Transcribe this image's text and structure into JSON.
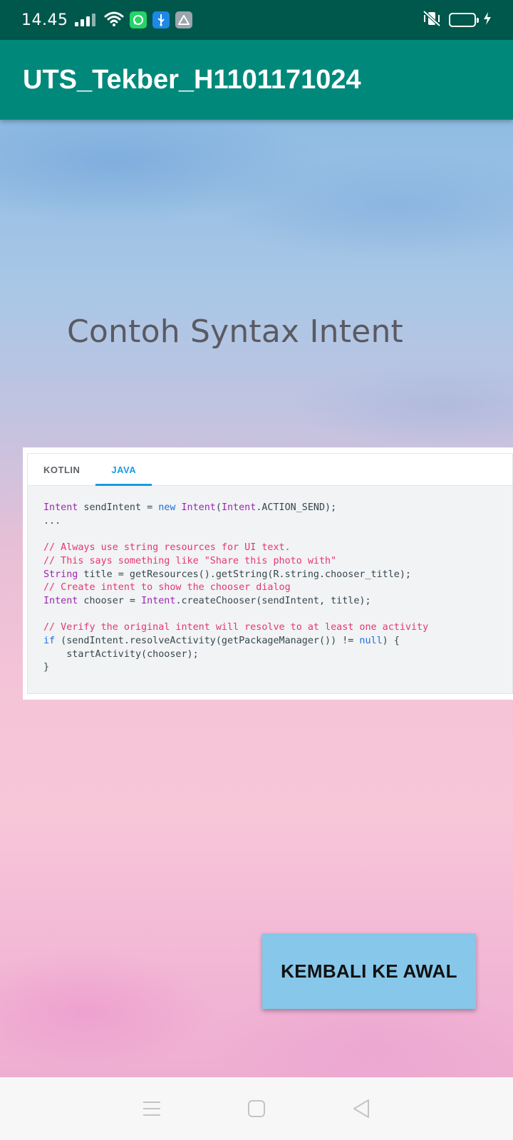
{
  "status_bar": {
    "time": "14.45",
    "icons": [
      "signal-icon",
      "wifi-icon",
      "whatsapp-icon",
      "usb-icon",
      "drive-icon",
      "vibrate-off-icon",
      "battery-icon",
      "charging-icon"
    ]
  },
  "app_bar": {
    "title": "UTS_Tekber_H1101171024",
    "color": "#00897b"
  },
  "main": {
    "heading": "Contoh Syntax Intent",
    "code_card": {
      "tabs": [
        {
          "label": "KOTLIN",
          "active": false
        },
        {
          "label": "JAVA",
          "active": true
        }
      ]
    },
    "back_button_label": "KEMBALI KE AWAL"
  },
  "nav_bar": {
    "buttons": [
      "menu-icon",
      "home-icon",
      "back-icon"
    ]
  },
  "colors": {
    "status_bar": "#00574b",
    "accent": "#1a9be2",
    "button": "#87c7ea"
  }
}
